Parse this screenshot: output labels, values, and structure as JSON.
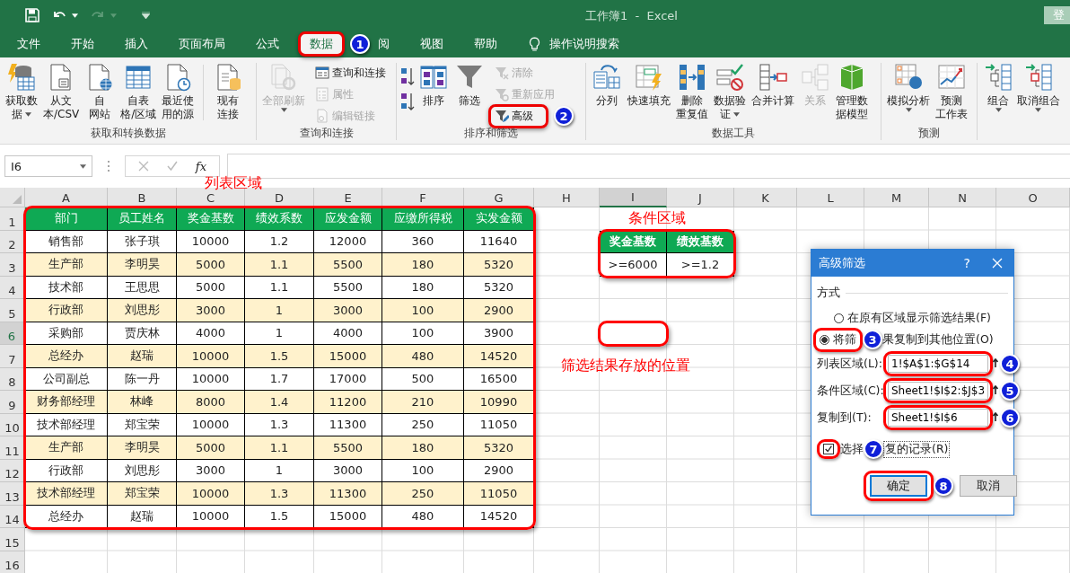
{
  "window": {
    "title": "工作簿1  -  Excel",
    "sign_in": "登"
  },
  "menu_tabs": [
    {
      "label": "文件",
      "selected": false,
      "highlighted": false
    },
    {
      "label": "开始",
      "selected": false,
      "highlighted": false
    },
    {
      "label": "插入",
      "selected": false,
      "highlighted": false
    },
    {
      "label": "页面布局",
      "selected": false,
      "highlighted": false
    },
    {
      "label": "公式",
      "selected": false,
      "highlighted": false
    },
    {
      "label": "数据",
      "selected": true,
      "highlighted": true,
      "marker": "1"
    },
    {
      "label": "阅",
      "selected": false,
      "highlighted": false
    },
    {
      "label": "视图",
      "selected": false,
      "highlighted": false
    },
    {
      "label": "帮助",
      "selected": false,
      "highlighted": false
    }
  ],
  "tell_me": "操作说明搜索",
  "ribbon": [
    {
      "label": "获取和转换数据",
      "items": [
        {
          "kind": "large",
          "lines": [
            "获取数",
            "据"
          ],
          "dropdown": true,
          "disabled": false
        },
        {
          "kind": "large",
          "lines": [
            "从文",
            "本/CSV"
          ],
          "dropdown": false,
          "disabled": false
        },
        {
          "kind": "large",
          "lines": [
            "自",
            "网站"
          ],
          "dropdown": false,
          "disabled": false
        },
        {
          "kind": "large",
          "lines": [
            "自表",
            "格/区域"
          ],
          "dropdown": false,
          "disabled": false
        },
        {
          "kind": "large",
          "lines": [
            "最近使",
            "用的源"
          ],
          "dropdown": false,
          "disabled": false
        },
        {
          "kind": "separator"
        },
        {
          "kind": "large",
          "lines": [
            "现有",
            "连接"
          ],
          "dropdown": false,
          "disabled": false
        }
      ]
    },
    {
      "label": "查询和连接",
      "items": [
        {
          "kind": "large",
          "lines": [
            "全部刷新"
          ],
          "dropdown": true,
          "disabled": true
        },
        {
          "kind": "stack",
          "items": [
            {
              "label": "查询和连接",
              "disabled": false,
              "highlighted": false
            },
            {
              "label": "属性",
              "disabled": true,
              "highlighted": false
            },
            {
              "label": "编辑链接",
              "disabled": true,
              "highlighted": false
            }
          ]
        }
      ]
    },
    {
      "label": "排序和筛选",
      "items": [
        {
          "kind": "sort-pair"
        },
        {
          "kind": "large",
          "lines": [
            "排序"
          ],
          "dropdown": false,
          "disabled": false
        },
        {
          "kind": "large",
          "lines": [
            "筛选"
          ],
          "dropdown": false,
          "disabled": false
        },
        {
          "kind": "stack",
          "items": [
            {
              "label": "清除",
              "disabled": true,
              "highlighted": false
            },
            {
              "label": "重新应用",
              "disabled": true,
              "highlighted": false
            },
            {
              "label": "高级",
              "disabled": false,
              "highlighted": true,
              "marker": "2"
            }
          ]
        }
      ]
    },
    {
      "label": "数据工具",
      "items": [
        {
          "kind": "large",
          "lines": [
            "分列"
          ],
          "dropdown": false,
          "disabled": false
        },
        {
          "kind": "large",
          "lines": [
            "快速填充"
          ],
          "dropdown": false,
          "disabled": false
        },
        {
          "kind": "large",
          "lines": [
            "删除",
            "重复值"
          ],
          "dropdown": false,
          "disabled": false
        },
        {
          "kind": "large",
          "lines": [
            "数据验",
            "证"
          ],
          "dropdown": true,
          "disabled": false
        },
        {
          "kind": "large",
          "lines": [
            "合并计算"
          ],
          "dropdown": false,
          "disabled": false
        },
        {
          "kind": "large",
          "lines": [
            "关系"
          ],
          "dropdown": false,
          "disabled": true
        },
        {
          "kind": "large",
          "lines": [
            "管理数",
            "据模型"
          ],
          "dropdown": false,
          "disabled": false
        }
      ]
    },
    {
      "label": "预测",
      "items": [
        {
          "kind": "large",
          "lines": [
            "模拟分析"
          ],
          "dropdown": true,
          "disabled": false
        },
        {
          "kind": "large",
          "lines": [
            "预测",
            "工作表"
          ],
          "dropdown": false,
          "disabled": false
        }
      ]
    },
    {
      "items": [
        {
          "kind": "large",
          "lines": [
            "组合"
          ],
          "dropdown": true,
          "disabled": false
        },
        {
          "kind": "large",
          "lines": [
            "取消组合"
          ],
          "dropdown": true,
          "disabled": false
        }
      ]
    }
  ],
  "formula_bar": {
    "name_box": "I6",
    "function_label": "fx"
  },
  "sheet": {
    "columns": [
      {
        "label": "A",
        "selected": false
      },
      {
        "label": "B",
        "selected": false
      },
      {
        "label": "C",
        "selected": false
      },
      {
        "label": "D",
        "selected": false
      },
      {
        "label": "E",
        "selected": false
      },
      {
        "label": "F",
        "selected": false
      },
      {
        "label": "G",
        "selected": false
      },
      {
        "label": "H",
        "selected": false
      },
      {
        "label": "I",
        "selected": true
      },
      {
        "label": "J",
        "selected": false
      },
      {
        "label": "K",
        "selected": false
      },
      {
        "label": "L",
        "selected": false
      },
      {
        "label": "M",
        "selected": false
      },
      {
        "label": "N",
        "selected": false
      },
      {
        "label": "O",
        "selected": false
      }
    ],
    "rows": [
      {
        "label": "1",
        "selected": false
      },
      {
        "label": "2",
        "selected": false
      },
      {
        "label": "3",
        "selected": false
      },
      {
        "label": "4",
        "selected": false
      },
      {
        "label": "5",
        "selected": false
      },
      {
        "label": "6",
        "selected": true
      },
      {
        "label": "7",
        "selected": false
      },
      {
        "label": "8",
        "selected": false
      },
      {
        "label": "9",
        "selected": false
      },
      {
        "label": "10",
        "selected": false
      },
      {
        "label": "11",
        "selected": false
      },
      {
        "label": "12",
        "selected": false
      },
      {
        "label": "13",
        "selected": false
      },
      {
        "label": "14",
        "selected": false
      },
      {
        "label": "15",
        "selected": false
      },
      {
        "label": "16",
        "selected": false
      }
    ],
    "list_range": {
      "label": "列表区域",
      "highlighted": true,
      "header": [
        "部门",
        "员工姓名",
        "奖金基数",
        "绩效系数",
        "应发金额",
        "应缴所得税",
        "实发金额"
      ],
      "rows": [
        {
          "shaded": false,
          "cells": [
            "销售部",
            "张子琪",
            "10000",
            "1.2",
            "12000",
            "360",
            "11640"
          ]
        },
        {
          "shaded": true,
          "cells": [
            "生产部",
            "李明昊",
            "5000",
            "1.1",
            "5500",
            "180",
            "5320"
          ]
        },
        {
          "shaded": false,
          "cells": [
            "技术部",
            "王思思",
            "5000",
            "1.1",
            "5500",
            "180",
            "5320"
          ]
        },
        {
          "shaded": true,
          "cells": [
            "行政部",
            "刘思彤",
            "3000",
            "1",
            "3000",
            "100",
            "2900"
          ]
        },
        {
          "shaded": false,
          "cells": [
            "采购部",
            "贾庆林",
            "4000",
            "1",
            "4000",
            "100",
            "3900"
          ]
        },
        {
          "shaded": true,
          "cells": [
            "总经办",
            "赵瑞",
            "10000",
            "1.5",
            "15000",
            "480",
            "14520"
          ]
        },
        {
          "shaded": false,
          "cells": [
            "公司副总",
            "陈一丹",
            "10000",
            "1.7",
            "17000",
            "500",
            "16500"
          ]
        },
        {
          "shaded": true,
          "cells": [
            "财务部经理",
            "林峰",
            "8000",
            "1.4",
            "11200",
            "210",
            "10990"
          ]
        },
        {
          "shaded": false,
          "cells": [
            "技术部经理",
            "郑宝荣",
            "10000",
            "1.3",
            "11300",
            "250",
            "11050"
          ]
        },
        {
          "shaded": true,
          "cells": [
            "生产部",
            "李明昊",
            "5000",
            "1.1",
            "5500",
            "180",
            "5320"
          ]
        },
        {
          "shaded": false,
          "cells": [
            "行政部",
            "刘思彤",
            "3000",
            "1",
            "3000",
            "100",
            "2900"
          ]
        },
        {
          "shaded": true,
          "cells": [
            "技术部经理",
            "郑宝荣",
            "10000",
            "1.3",
            "11300",
            "250",
            "11050"
          ]
        },
        {
          "shaded": false,
          "cells": [
            "总经办",
            "赵瑞",
            "10000",
            "1.5",
            "15000",
            "480",
            "14520"
          ]
        }
      ]
    },
    "criteria_range": {
      "label": "条件区域",
      "highlighted": true,
      "header": [
        "奖金基数",
        "绩效基数"
      ],
      "rows": [
        [
          ">=6000",
          ">=1.2"
        ]
      ]
    },
    "output": {
      "label": "筛选结果存放的位置",
      "highlighted": true
    }
  },
  "dialog": {
    "title": "高级筛选",
    "help": "?",
    "section": "方式",
    "options": [
      {
        "label_parts": [
          "在原有区域显示筛选结果(F)"
        ],
        "selected": false,
        "highlighted": false
      },
      {
        "label_parts": [
          "将筛",
          "果复制到其他位置(O)"
        ],
        "selected": true,
        "highlighted": true,
        "marker": "3"
      }
    ],
    "fields": [
      {
        "label": "列表区域(L):",
        "value": "1!$A$1:$G$14",
        "highlighted": true,
        "marker": "4"
      },
      {
        "label": "条件区域(C):",
        "value": "Sheet1!$I$2:$J$3",
        "highlighted": true,
        "marker": "5"
      },
      {
        "label": "复制到(T):",
        "value": "Sheet1!$I$6",
        "highlighted": true,
        "marker": "6"
      }
    ],
    "unique": {
      "label_parts": [
        "选择",
        "复的记录(R)"
      ],
      "checked": true,
      "highlighted": true,
      "marker": "7"
    },
    "buttons": [
      {
        "label": "确定",
        "default": true,
        "highlighted": true,
        "marker": "8"
      },
      {
        "label": "取消",
        "default": false,
        "highlighted": false
      }
    ]
  }
}
